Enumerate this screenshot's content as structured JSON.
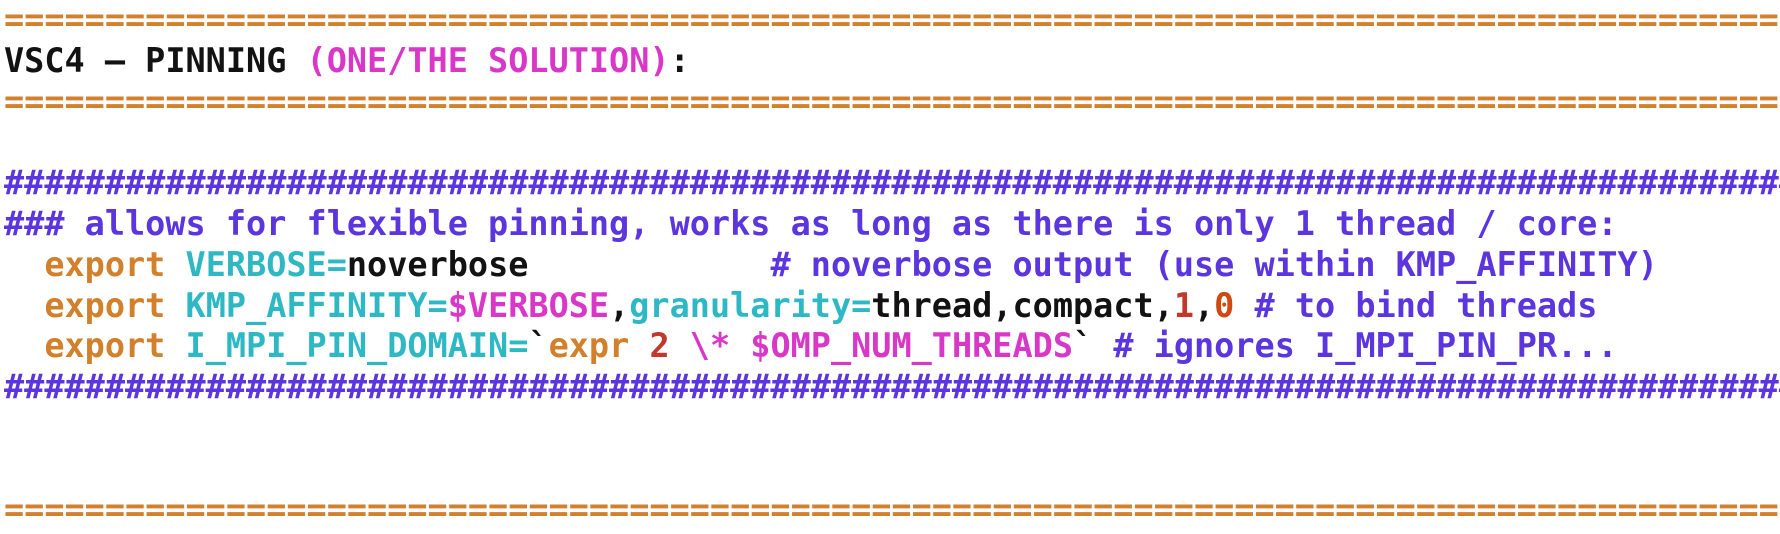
{
  "terminal": {
    "background": "#ffffff",
    "palette": {
      "rule_orange": "#d2802c",
      "comment_purple": "#5b35dd",
      "keyword_orange": "#d2802c",
      "var_cyan": "#2eb8c4",
      "magenta": "#d837c8",
      "plain_black": "#121212",
      "number_red": "#c0392b",
      "number_orange": "#cf4a12"
    },
    "lines": [
      {
        "name": "rule-top",
        "segments": [
          {
            "text": "================================================================================================",
            "color": "#d2802c",
            "bold": true
          }
        ]
      },
      {
        "name": "title-line",
        "segments": [
          {
            "text": "VSC4 – PINNING ",
            "color": "#121212",
            "bold": true
          },
          {
            "text": "(ONE/THE SOLUTION)",
            "color": "#d837c8",
            "bold": true
          },
          {
            "text": ":",
            "color": "#121212",
            "bold": true
          }
        ]
      },
      {
        "name": "rule-under-title",
        "segments": [
          {
            "text": "================================================================================================",
            "color": "#d2802c",
            "bold": true
          }
        ]
      },
      {
        "name": "blank-1",
        "segments": [
          {
            "text": " ",
            "color": "#ffffff",
            "bold": false
          }
        ]
      },
      {
        "name": "hash-rule-top",
        "segments": [
          {
            "text": "###############################################################################################",
            "color": "#5b35dd",
            "bold": true
          }
        ]
      },
      {
        "name": "comment-allows-flexible-pinning",
        "segments": [
          {
            "text": "### allows for flexible pinning, works as long as there is only 1 thread / core:",
            "color": "#5b35dd",
            "bold": true
          }
        ]
      },
      {
        "name": "export-verbose-line",
        "segments": [
          {
            "text": "  ",
            "color": "#121212",
            "bold": true
          },
          {
            "text": "export",
            "color": "#d2802c",
            "bold": true
          },
          {
            "text": " ",
            "color": "#121212",
            "bold": true
          },
          {
            "text": "VERBOSE=",
            "color": "#2eb8c4",
            "bold": true
          },
          {
            "text": "noverbose",
            "color": "#121212",
            "bold": true
          },
          {
            "text": "            ",
            "color": "#121212",
            "bold": true
          },
          {
            "text": "# noverbose output (use within KMP_AFFINITY)",
            "color": "#5b35dd",
            "bold": true
          }
        ]
      },
      {
        "name": "export-kmp-affinity-line",
        "segments": [
          {
            "text": "  ",
            "color": "#121212",
            "bold": true
          },
          {
            "text": "export",
            "color": "#d2802c",
            "bold": true
          },
          {
            "text": " ",
            "color": "#121212",
            "bold": true
          },
          {
            "text": "KMP_AFFINITY=",
            "color": "#2eb8c4",
            "bold": true
          },
          {
            "text": "$VERBOSE",
            "color": "#d837c8",
            "bold": true
          },
          {
            "text": ",",
            "color": "#121212",
            "bold": true
          },
          {
            "text": "granularity=",
            "color": "#2eb8c4",
            "bold": true
          },
          {
            "text": "thread,compact,",
            "color": "#121212",
            "bold": true
          },
          {
            "text": "1",
            "color": "#c0392b",
            "bold": true
          },
          {
            "text": ",",
            "color": "#121212",
            "bold": true
          },
          {
            "text": "0",
            "color": "#cf4a12",
            "bold": true
          },
          {
            "text": " ",
            "color": "#121212",
            "bold": true
          },
          {
            "text": "# to bind threads",
            "color": "#5b35dd",
            "bold": true
          }
        ]
      },
      {
        "name": "export-i-mpi-pin-domain-line",
        "segments": [
          {
            "text": "  ",
            "color": "#121212",
            "bold": true
          },
          {
            "text": "export",
            "color": "#d2802c",
            "bold": true
          },
          {
            "text": " ",
            "color": "#121212",
            "bold": true
          },
          {
            "text": "I_MPI_PIN_DOMAIN=",
            "color": "#2eb8c4",
            "bold": true
          },
          {
            "text": "`",
            "color": "#121212",
            "bold": true
          },
          {
            "text": "expr",
            "color": "#d2802c",
            "bold": true
          },
          {
            "text": " ",
            "color": "#121212",
            "bold": true
          },
          {
            "text": "2",
            "color": "#c0392b",
            "bold": true
          },
          {
            "text": " ",
            "color": "#121212",
            "bold": true
          },
          {
            "text": "\\* $OMP_NUM_THREADS",
            "color": "#d837c8",
            "bold": true
          },
          {
            "text": "`",
            "color": "#121212",
            "bold": true
          },
          {
            "text": " ",
            "color": "#121212",
            "bold": true
          },
          {
            "text": "# ignores I_MPI_PIN_PR...",
            "color": "#5b35dd",
            "bold": true
          }
        ]
      },
      {
        "name": "hash-rule-bottom",
        "segments": [
          {
            "text": "###############################################################################################",
            "color": "#5b35dd",
            "bold": true
          }
        ]
      },
      {
        "name": "blank-2",
        "segments": [
          {
            "text": " ",
            "color": "#ffffff",
            "bold": false
          }
        ]
      },
      {
        "name": "blank-3",
        "segments": [
          {
            "text": " ",
            "color": "#ffffff",
            "bold": false
          }
        ]
      },
      {
        "name": "rule-bottom",
        "segments": [
          {
            "text": "================================================================================================",
            "color": "#d2802c",
            "bold": true
          }
        ]
      }
    ]
  }
}
